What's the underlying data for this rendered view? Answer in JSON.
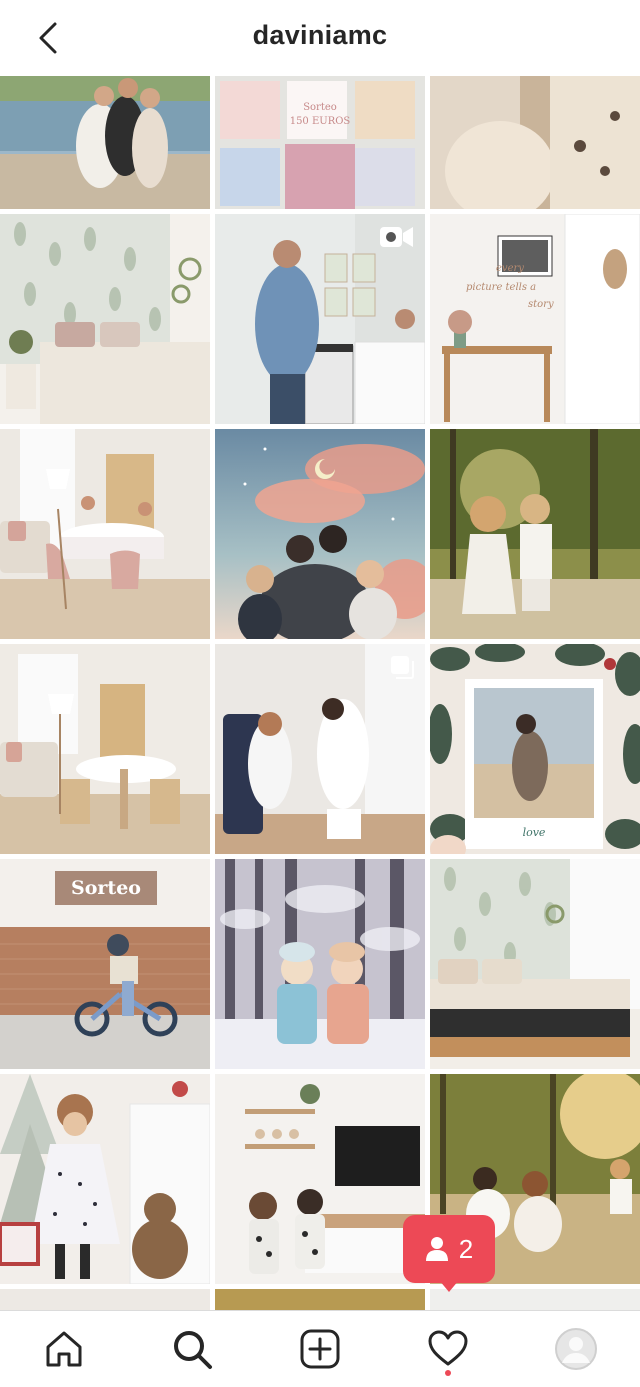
{
  "header": {
    "username": "daviniamc"
  },
  "posts": [
    {
      "name": "post-family-lake"
    },
    {
      "name": "post-sorteo-collage",
      "caption": "Sorteo\n150 EUROS"
    },
    {
      "name": "post-pregnant-belly"
    },
    {
      "name": "post-bedroom-leaves"
    },
    {
      "name": "post-bathroom-video",
      "type": "video"
    },
    {
      "name": "post-entry-console",
      "type": "carousel",
      "wall_text": "every picture tells a story"
    },
    {
      "name": "post-dining-room-kids"
    },
    {
      "name": "post-family-clouds"
    },
    {
      "name": "post-kids-field"
    },
    {
      "name": "post-dining-room"
    },
    {
      "name": "post-clinic-visit",
      "type": "carousel"
    },
    {
      "name": "post-polaroid-love",
      "polaroid_text": "love"
    },
    {
      "name": "post-kid-bike",
      "label": "Sorteo"
    },
    {
      "name": "post-kids-snow"
    },
    {
      "name": "post-bedroom-bed"
    },
    {
      "name": "post-girl-christmas"
    },
    {
      "name": "post-tv-room-kids"
    },
    {
      "name": "post-family-sunset"
    }
  ],
  "notification": {
    "count": "2",
    "icon": "person-icon"
  },
  "bottom_nav": [
    {
      "name": "home",
      "icon": "home-icon"
    },
    {
      "name": "search",
      "icon": "search-icon",
      "active": true
    },
    {
      "name": "new-post",
      "icon": "plus-square-icon"
    },
    {
      "name": "activity",
      "icon": "heart-icon"
    },
    {
      "name": "profile",
      "icon": "avatar-icon"
    }
  ],
  "colors": {
    "text": "#262626",
    "accent": "#ed4956",
    "border": "#dbdbdb"
  }
}
